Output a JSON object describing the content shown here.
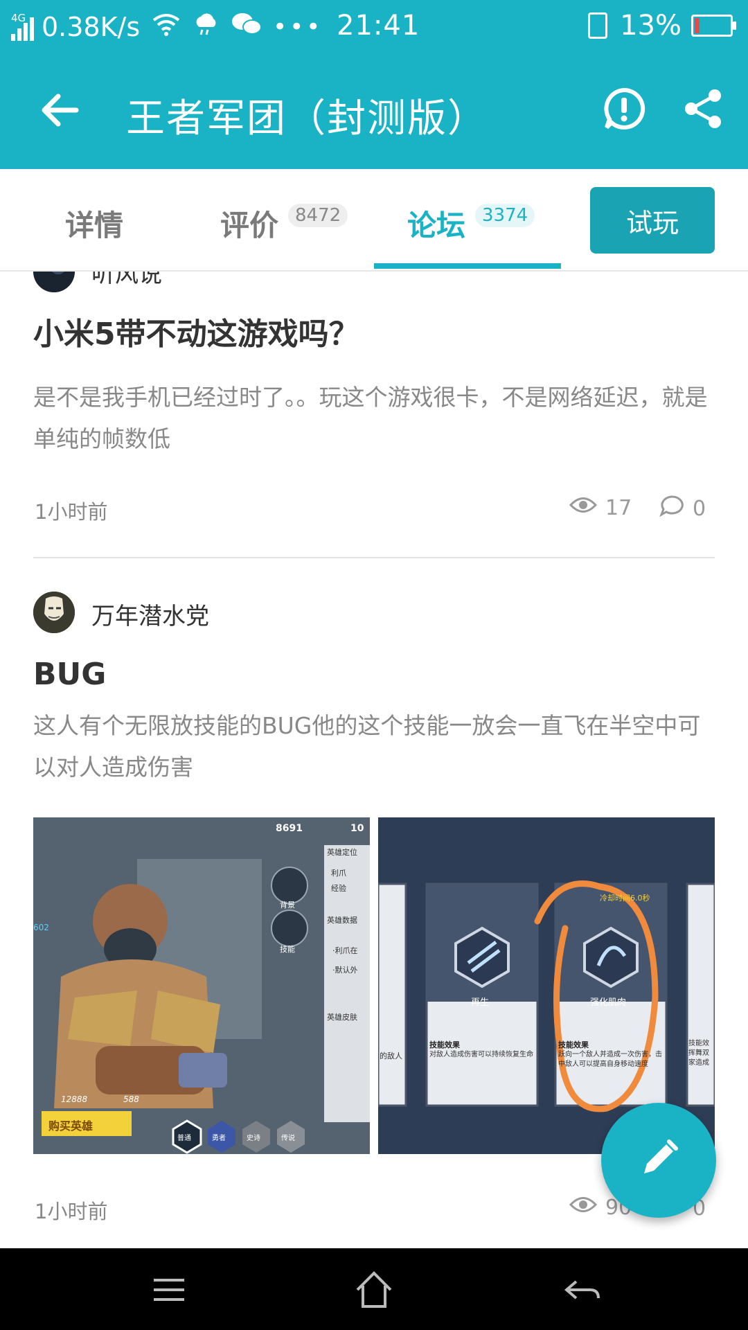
{
  "status_bar": {
    "network": "4G",
    "speed": "0.38K/s",
    "time": "21:41",
    "battery": "13%",
    "icons": [
      "signal-icon",
      "wifi-icon",
      "weather-icon",
      "wechat-icon",
      "more-icon",
      "vibrate-icon",
      "battery-icon"
    ]
  },
  "app_bar": {
    "title": "王者军团（封测版）",
    "icons": [
      "back-arrow-icon",
      "report-icon",
      "share-icon"
    ]
  },
  "tabs": {
    "items": [
      {
        "label": "详情",
        "count": ""
      },
      {
        "label": "评价",
        "count": "8472"
      },
      {
        "label": "论坛",
        "count": "3374"
      }
    ],
    "active": "论坛",
    "try_button": "试玩"
  },
  "posts": [
    {
      "author": "听风说",
      "title": "小米5带不动这游戏吗？",
      "body": "是不是我手机已经过时了。。玩这个游戏很卡，不是网络延迟，就是单纯的帧数低",
      "time": "1小时前",
      "views": "17",
      "comments": "0"
    },
    {
      "author": "万年潜水党",
      "title": "BUG",
      "body": "这人有个无限放技能的BUG他的这个技能一放会一直飞在半空中可以对人造成伤害",
      "time": "1小时前",
      "views": "90",
      "comments": "0",
      "images": [
        {
          "name": "game-hero-screenshot",
          "coins": "8691",
          "gems": "10",
          "side_labels": [
            "英雄定位",
            "利爪",
            "经验",
            "英雄数据",
            "·利爪在",
            "·默认外",
            "英雄皮肤"
          ],
          "skill_labels": [
            "背景",
            "技能"
          ],
          "hp": "602",
          "bottom_counts": [
            "12888",
            "588"
          ],
          "buy_button": "购买英雄",
          "tiers": [
            "普通",
            "勇者",
            "史诗",
            "传说"
          ]
        },
        {
          "name": "game-skills-screenshot",
          "cooldown": "冷却时间6.0秒",
          "card_left_text": "的敌人",
          "skills": [
            {
              "name": "再生",
              "effect_title": "技能效果",
              "effect": "对敌人造成伤害可以持续恢复生命"
            },
            {
              "name": "强化肌肉",
              "effect_title": "技能效果",
              "effect": "跃向一个敌人并造成一次伤害，击中敌人可以提高自身移动速度"
            }
          ],
          "card_right_text": "技能效 挥舞双 家造成"
        }
      ]
    }
  ],
  "colors": {
    "accent": "#1ab3c6",
    "try_button": "#1aa3b2",
    "annotation": "#f08a3c"
  }
}
